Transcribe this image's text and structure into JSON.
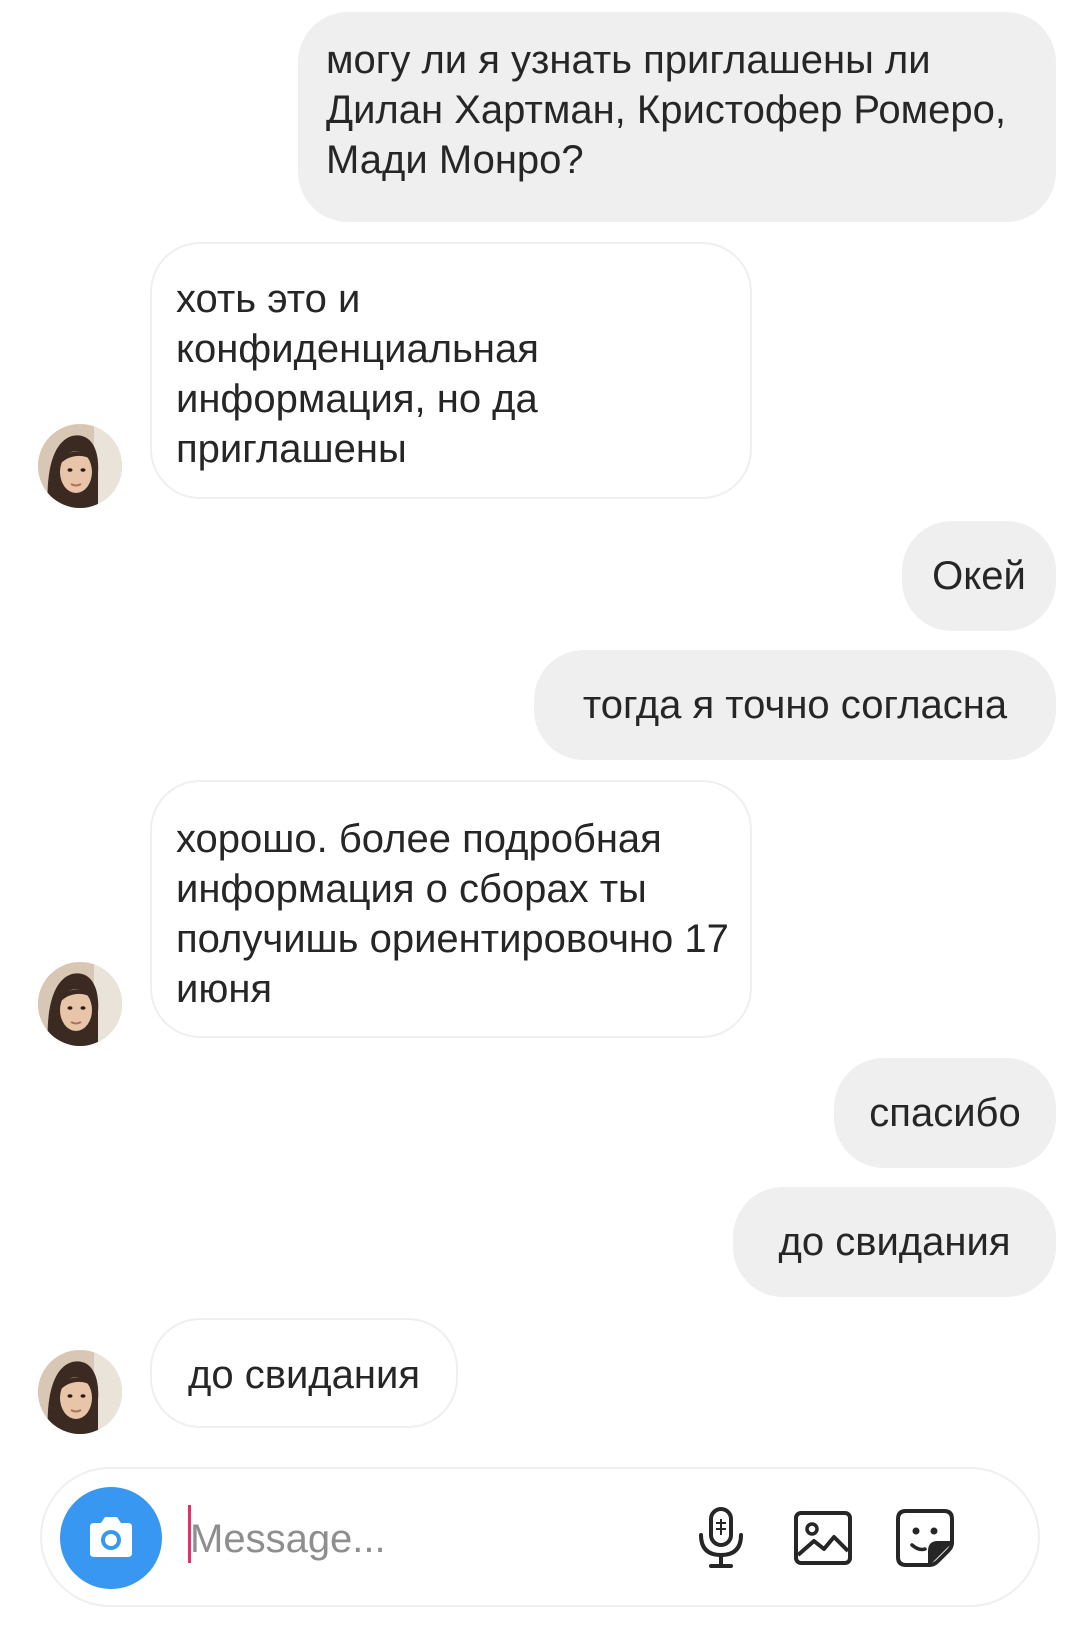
{
  "conversation": {
    "messages": [
      {
        "direction": "sent",
        "text": "могу ли я узнать приглашены ли Дилан Хартман, Кристофер Ромеро, Мади Монро?"
      },
      {
        "direction": "received",
        "text": "хоть это и конфиденциальная информация,  но да приглашены"
      },
      {
        "direction": "sent",
        "text": "Окей"
      },
      {
        "direction": "sent",
        "text": "тогда я точно согласна"
      },
      {
        "direction": "received",
        "text": "хорошо. более подробная информация о сборах ты получишь ориентировочно 17 июня"
      },
      {
        "direction": "sent",
        "text": "спасибо"
      },
      {
        "direction": "sent",
        "text": "до свидания"
      },
      {
        "direction": "received",
        "text": "до свидания"
      }
    ]
  },
  "composer": {
    "placeholder": "Message...",
    "camera_icon": "camera-icon",
    "mic_icon": "microphone-icon",
    "gallery_icon": "gallery-icon",
    "sticker_icon": "sticker-icon"
  },
  "colors": {
    "sent_bubble": "#efefef",
    "received_border": "#efefef",
    "accent": "#3897f0",
    "caret": "#e1306c"
  }
}
